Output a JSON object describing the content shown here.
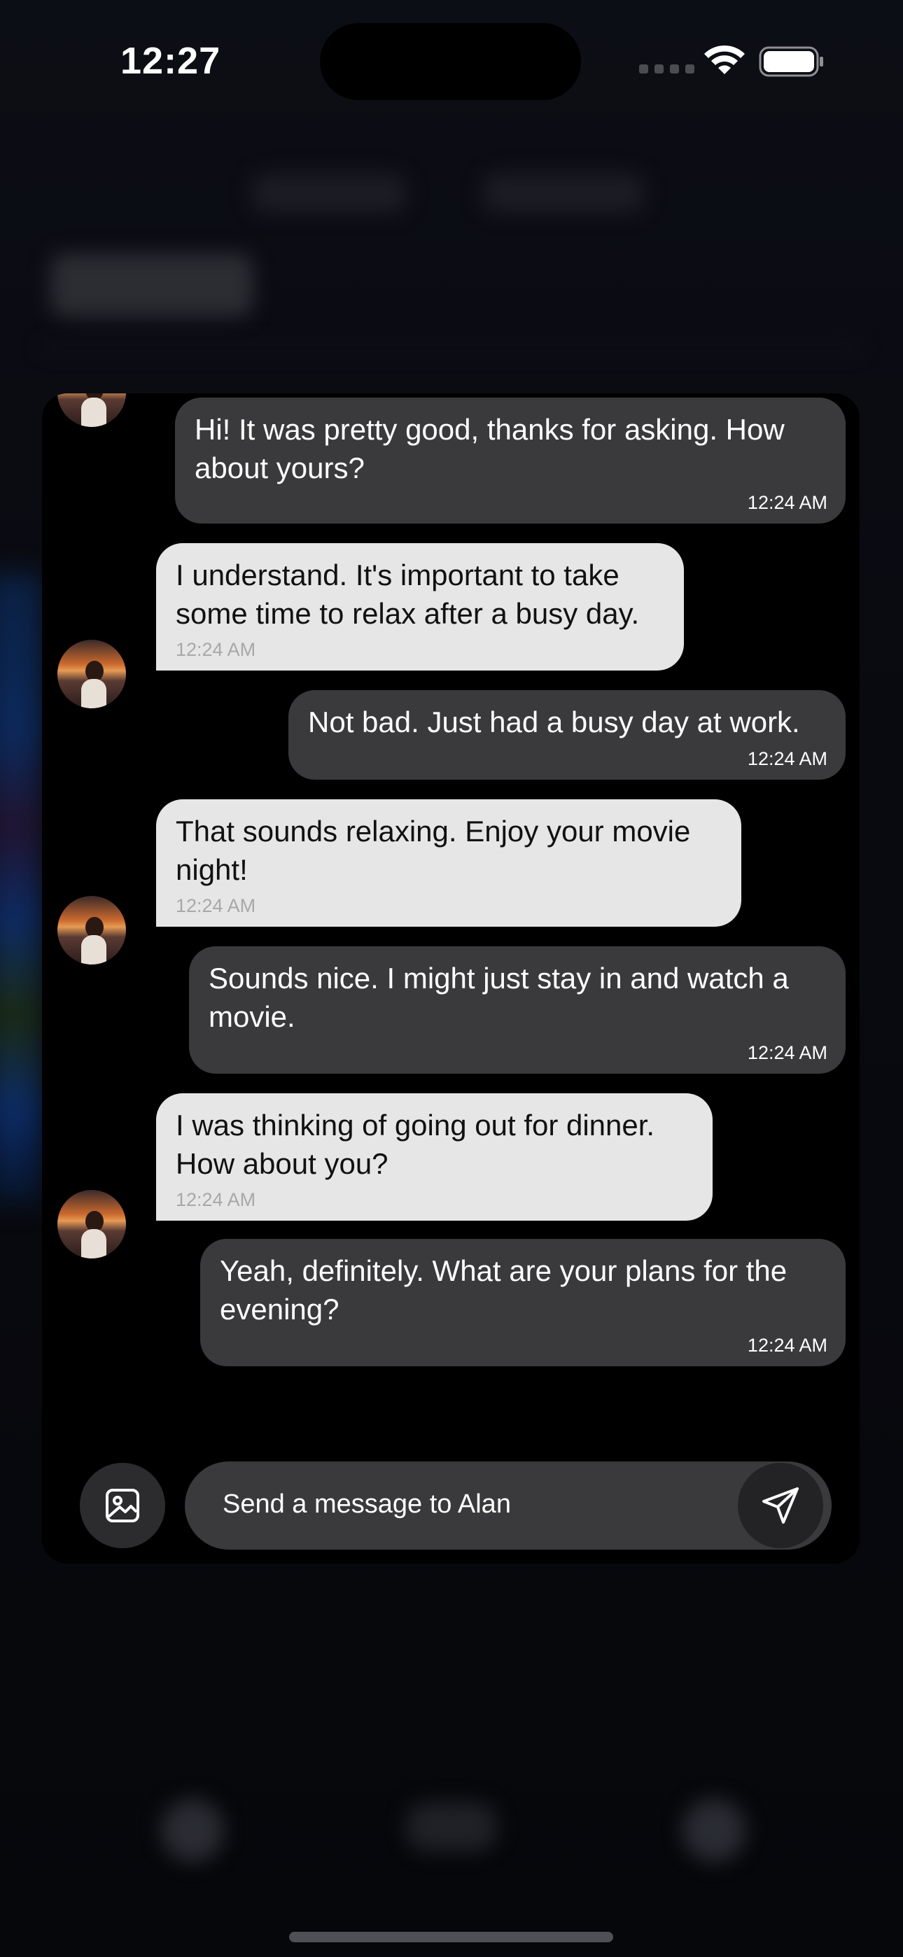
{
  "status_bar": {
    "time": "12:27"
  },
  "chat": {
    "messages": [
      {
        "side": "sent",
        "text": "Hi! It was pretty good, thanks for asking. How about yours?",
        "time": "12:24 AM"
      },
      {
        "side": "recv",
        "text": "I understand. It's important to take some time to relax after a busy day.",
        "time": "12:24 AM"
      },
      {
        "side": "sent",
        "text": "Not bad. Just had a busy day at work.",
        "time": "12:24 AM"
      },
      {
        "side": "recv",
        "text": "That sounds relaxing. Enjoy your movie night!",
        "time": "12:24 AM"
      },
      {
        "side": "sent",
        "text": "Sounds nice. I might just stay in and watch a movie.",
        "time": "12:24 AM"
      },
      {
        "side": "recv",
        "text": "I was thinking of going out for dinner. How about you?",
        "time": "12:24 AM"
      },
      {
        "side": "sent",
        "text": "Yeah, definitely. What are your plans for the evening?",
        "time": "12:24 AM"
      }
    ]
  },
  "composer": {
    "placeholder": "Send a message to Alan",
    "image_icon": "image-icon",
    "send_icon": "paper-plane-icon"
  },
  "colors": {
    "sent_bubble": "#3a3a3c",
    "received_bubble": "#e6e6e6",
    "panel_background": "#000000"
  }
}
